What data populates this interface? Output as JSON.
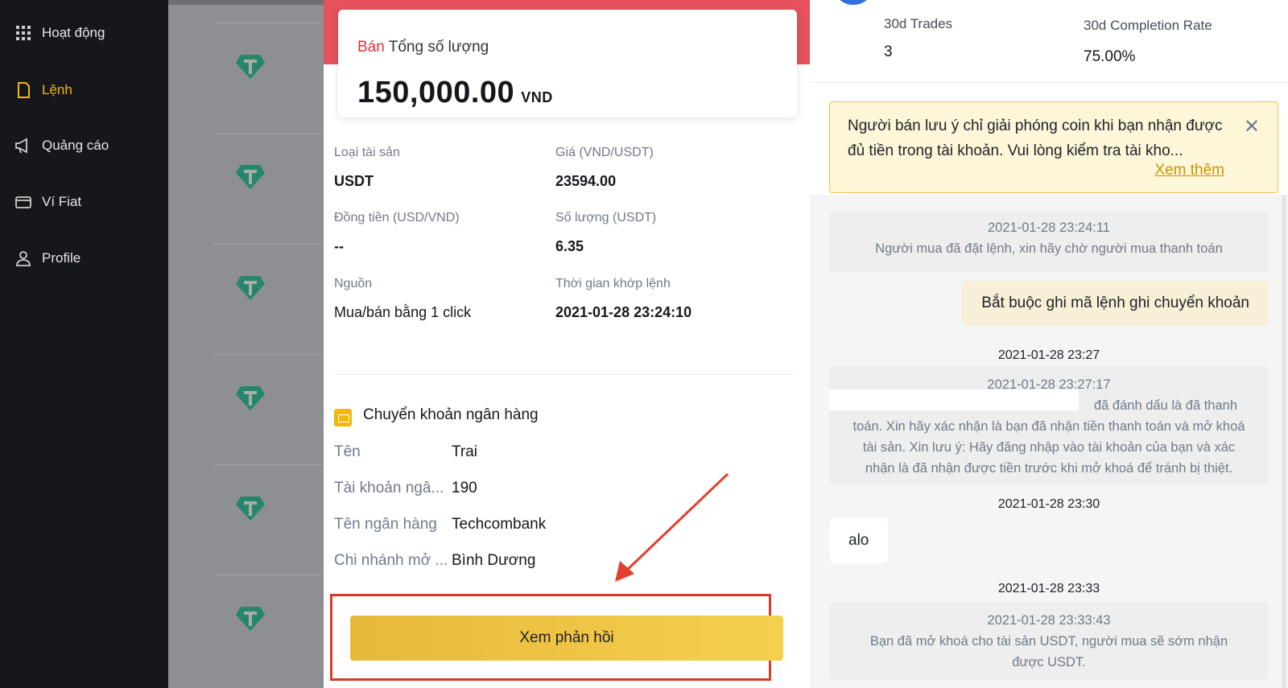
{
  "sidebar": {
    "items": [
      {
        "label": "Hoạt động",
        "icon": "grid-icon",
        "active": false
      },
      {
        "label": "Lệnh",
        "icon": "document-icon",
        "active": true
      },
      {
        "label": "Quảng cáo",
        "icon": "megaphone-icon",
        "active": false
      },
      {
        "label": "Ví Fiat",
        "icon": "wallet-icon",
        "active": false
      },
      {
        "label": "Profile",
        "icon": "user-icon",
        "active": false
      }
    ],
    "accent_color": "#f0b90b"
  },
  "order": {
    "side": "Bán",
    "total_label": "Tổng số lượng",
    "amount": "150,000.00",
    "currency": "VND",
    "fields": [
      {
        "label": "Loại tài sản",
        "value": "USDT"
      },
      {
        "label": "Giá (VND/USDT)",
        "value": "23594.00"
      },
      {
        "label": "Đồng tiền (USD/VND)",
        "value": "--"
      },
      {
        "label": "Số lượng (USDT)",
        "value": "6.35"
      },
      {
        "label": "Nguồn",
        "value": "Mua/bán bằng 1 click"
      },
      {
        "label": "Thời gian khớp lệnh",
        "value": "2021-01-28 23:24:10"
      }
    ]
  },
  "bank": {
    "title": "Chuyển khoản ngân hàng",
    "rows": [
      {
        "label": "Tên",
        "value": "Trai"
      },
      {
        "label": "Tài khoản ngâ...",
        "value": "190"
      },
      {
        "label": "Tên ngân hàng",
        "value": "Techcombank"
      },
      {
        "label": "Chi nhánh mở ...",
        "value": "Bình Dương"
      }
    ]
  },
  "action_button": "Xem phản hồi",
  "stats": {
    "trades_label": "30d Trades",
    "trades_value": "3",
    "completion_label": "30d Completion Rate",
    "completion_value": "75.00%"
  },
  "notice": {
    "text": "Người bán lưu ý chỉ giải phóng coin khi bạn nhận được đủ tiền trong tài khoản. Vui lòng kiểm tra tài kho...",
    "more": "Xem thêm",
    "close": "✕"
  },
  "chat": {
    "sys1_time": "2021-01-28 23:24:11",
    "sys1_text": "Người mua đã đặt lệnh, xin hãy chờ người mua thanh toán",
    "me1": "Bắt buộc ghi mã lệnh ghi chuyển khoản",
    "t1": "2021-01-28 23:27",
    "sys2_time": "2021-01-28 23:27:17",
    "sys2_text": "đã đánh dấu là đã thanh toán. Xin hãy xác nhận là bạn đã nhận tiền thanh toán và mở khoá tài sản. Xin lưu ý: Hãy đăng nhập vào tài khoản của bạn và xác nhận là đã nhận được tiền trước khi mở khoá để tránh bị thiệt.",
    "t2": "2021-01-28 23:30",
    "them1": "alo",
    "t3": "2021-01-28 23:33",
    "sys3_time": "2021-01-28 23:33:43",
    "sys3_text": "Bạn đã mở khoá cho tài sản USDT, người mua sẽ sớm nhận được USDT."
  }
}
